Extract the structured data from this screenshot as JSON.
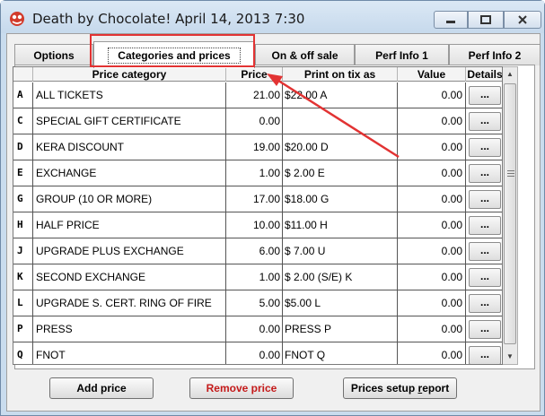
{
  "window": {
    "title": "Death by Chocolate! April 14, 2013 7:30",
    "controls": [
      "minimize",
      "maximize",
      "close"
    ]
  },
  "tabs": [
    {
      "label": "Options",
      "active": false
    },
    {
      "label": "Categories and prices",
      "active": true
    },
    {
      "label": "On & off sale",
      "active": false
    },
    {
      "label": "Perf Info 1",
      "active": false
    },
    {
      "label": "Perf Info 2",
      "active": false
    }
  ],
  "grid": {
    "headers": {
      "category": "Price category",
      "price": "Price",
      "tix": "Print on tix as",
      "value": "Value",
      "details": "Details"
    },
    "details_button_label": "...",
    "rows": [
      {
        "code": "A",
        "category": "ALL TICKETS",
        "price": "21.00",
        "tix": "$22.00 A",
        "value": "0.00"
      },
      {
        "code": "C",
        "category": "SPECIAL GIFT CERTIFICATE",
        "price": "0.00",
        "tix": "",
        "value": "0.00"
      },
      {
        "code": "D",
        "category": "KERA DISCOUNT",
        "price": "19.00",
        "tix": "$20.00 D",
        "value": "0.00"
      },
      {
        "code": "E",
        "category": "EXCHANGE",
        "price": "1.00",
        "tix": "$  2.00 E",
        "value": "0.00"
      },
      {
        "code": "G",
        "category": "GROUP (10 OR MORE)",
        "price": "17.00",
        "tix": "$18.00 G",
        "value": "0.00"
      },
      {
        "code": "H",
        "category": "HALF PRICE",
        "price": "10.00",
        "tix": "$11.00 H",
        "value": "0.00"
      },
      {
        "code": "J",
        "category": "UPGRADE PLUS EXCHANGE",
        "price": "6.00",
        "tix": "$  7.00 U",
        "value": "0.00"
      },
      {
        "code": "K",
        "category": "SECOND EXCHANGE",
        "price": "1.00",
        "tix": "$  2.00  (S/E)  K",
        "value": "0.00"
      },
      {
        "code": "L",
        "category": "UPGRADE S. CERT.  RING OF FIRE",
        "price": "5.00",
        "tix": "$5.00 L",
        "value": "0.00"
      },
      {
        "code": "P",
        "category": "PRESS",
        "price": "0.00",
        "tix": "PRESS  P",
        "value": "0.00"
      },
      {
        "code": "Q",
        "category": "FNOT",
        "price": "0.00",
        "tix": "FNOT  Q",
        "value": "0.00"
      }
    ]
  },
  "buttons": {
    "add": "Add price",
    "remove": "Remove price",
    "setup_report_prefix": "Prices setup ",
    "setup_report_underlined": "r",
    "setup_report_suffix": "eport"
  },
  "colors": {
    "annotation_red": "#e23333",
    "remove_text": "#c41a1a",
    "title_bar": "#c9dcee"
  }
}
